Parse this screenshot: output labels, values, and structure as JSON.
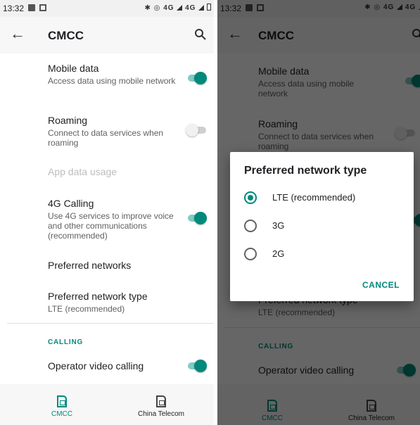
{
  "status_bar": {
    "time": "13:32",
    "network_label": "4G"
  },
  "app_bar": {
    "title": "CMCC"
  },
  "settings": {
    "mobile_data": {
      "title": "Mobile data",
      "summary": "Access data using mobile network",
      "enabled": true
    },
    "roaming": {
      "title": "Roaming",
      "summary": "Connect to data services when roaming",
      "enabled": false
    },
    "app_data_usage": {
      "title": "App data usage"
    },
    "calling_4g": {
      "title": "4G Calling",
      "summary": "Use 4G services to improve voice and other communications (recommended)",
      "enabled": true
    },
    "preferred_networks": {
      "title": "Preferred networks"
    },
    "preferred_network_type": {
      "title": "Preferred network type",
      "summary": "LTE (recommended)"
    },
    "calling_section": "CALLING",
    "operator_video_calling": {
      "title": "Operator video calling",
      "enabled": true
    }
  },
  "bottom_tabs": [
    {
      "label": "CMCC",
      "active": true
    },
    {
      "label": "China Telecom",
      "active": false
    }
  ],
  "dialog": {
    "title": "Preferred network type",
    "options": [
      {
        "label": "LTE (recommended)",
        "selected": true
      },
      {
        "label": "3G",
        "selected": false
      },
      {
        "label": "2G",
        "selected": false
      }
    ],
    "cancel_label": "CANCEL"
  },
  "colors": {
    "accent": "#00897b",
    "accent_light": "#80cbc4",
    "scrim": "rgba(0,0,0,0.6)"
  },
  "icons": [
    "back-arrow-icon",
    "search-icon",
    "sim-card-icon",
    "bluetooth-icon",
    "hotspot-icon",
    "signal-icon",
    "battery-icon"
  ]
}
